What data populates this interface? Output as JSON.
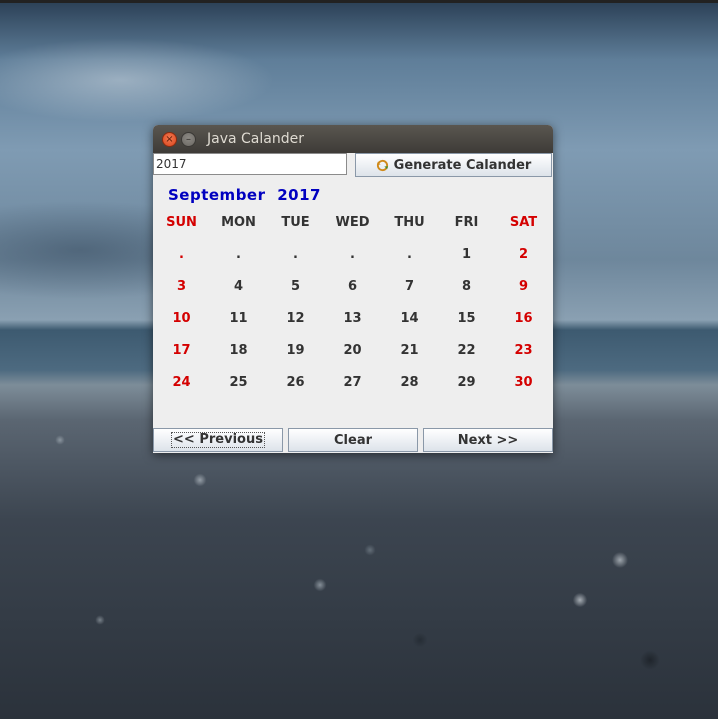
{
  "window": {
    "title": "Java Calander"
  },
  "input": {
    "year_value": "2017"
  },
  "buttons": {
    "generate": "Generate Calander",
    "previous": "<< Previous",
    "clear": "Clear",
    "next": "Next >>"
  },
  "calendar": {
    "month": "September",
    "year": "2017",
    "days": [
      "SUN",
      "MON",
      "TUE",
      "WED",
      "THU",
      "FRI",
      "SAT"
    ],
    "weeks": [
      [
        ".",
        ".",
        ".",
        ".",
        ".",
        "1",
        "2"
      ],
      [
        "3",
        "4",
        "5",
        "6",
        "7",
        "8",
        "9"
      ],
      [
        "10",
        "11",
        "12",
        "13",
        "14",
        "15",
        "16"
      ],
      [
        "17",
        "18",
        "19",
        "20",
        "21",
        "22",
        "23"
      ],
      [
        "24",
        "25",
        "26",
        "27",
        "28",
        "29",
        "30"
      ]
    ]
  },
  "colors": {
    "weekend": "#d40000",
    "month_label": "#0000c0",
    "weekday": "#333333"
  },
  "icons": {
    "close": "close-icon",
    "minimize": "minimize-icon",
    "generate": "refresh-icon"
  }
}
